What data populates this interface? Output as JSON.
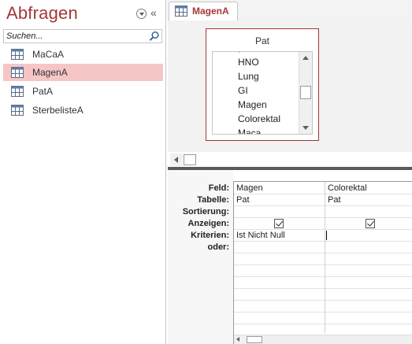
{
  "nav": {
    "title": "Abfragen",
    "search_placeholder": "Suchen...",
    "items": [
      {
        "label": "MaCaA",
        "selected": false
      },
      {
        "label": "MagenA",
        "selected": true
      },
      {
        "label": "PatA",
        "selected": false
      },
      {
        "label": "SterbelisteA",
        "selected": false
      }
    ]
  },
  "document_tab": {
    "label": "MagenA"
  },
  "table_box": {
    "name": "Pat",
    "fields": [
      "HNO",
      "Lung",
      "GI",
      "Magen",
      "Colorektal",
      "Maca"
    ]
  },
  "grid": {
    "row_labels": {
      "feld": "Feld:",
      "tabelle": "Tabelle:",
      "sortierung": "Sortierung:",
      "anzeigen": "Anzeigen:",
      "kriterien": "Kriterien:",
      "oder": "oder:"
    },
    "columns": [
      {
        "feld": "Magen",
        "tabelle": "Pat",
        "sortierung": "",
        "anzeigen": true,
        "kriterien": "Ist Nicht Null"
      },
      {
        "feld": "Colorektal",
        "tabelle": "Pat",
        "sortierung": "",
        "anzeigen": true,
        "kriterien": ""
      }
    ]
  },
  "colors": {
    "accent": "#a4373a",
    "selection": "#f6c6c6"
  },
  "icons": [
    "query-icon",
    "search-icon",
    "chevron-down-icon",
    "collapse-icon"
  ]
}
